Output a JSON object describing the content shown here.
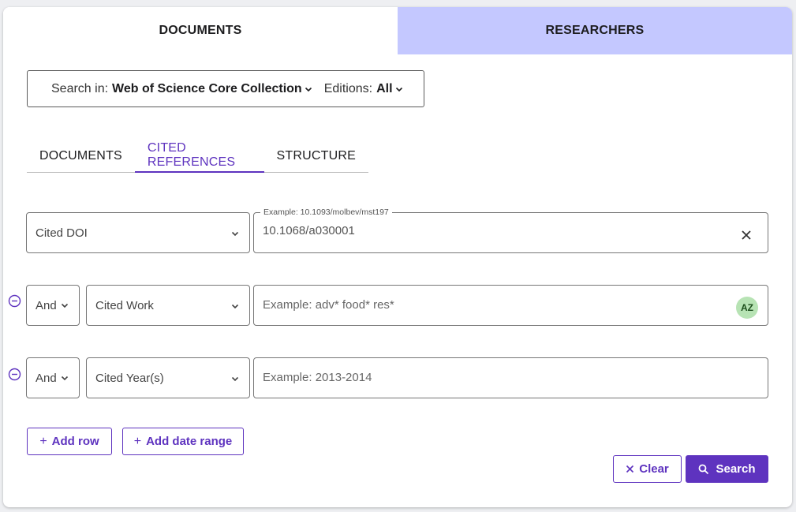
{
  "top_tabs": {
    "documents": "DOCUMENTS",
    "researchers": "RESEARCHERS"
  },
  "search_in": {
    "label": "Search in:",
    "collection": "Web of Science Core Collection",
    "editions_label": "Editions:",
    "editions_value": "All"
  },
  "sub_tabs": [
    "DOCUMENTS",
    "CITED REFERENCES",
    "STRUCTURE"
  ],
  "active_sub_tab": "CITED REFERENCES",
  "rows": [
    {
      "field": "Cited DOI",
      "label": "Example: 10.1093/molbev/mst197",
      "value": "10.1068/a030001"
    },
    {
      "operator": "And",
      "field": "Cited Work",
      "placeholder": "Example: adv* food* res*",
      "az_icon": "AZ"
    },
    {
      "operator": "And",
      "field": "Cited Year(s)",
      "placeholder": "Example: 2013-2014"
    }
  ],
  "buttons": {
    "add_row": "Add row",
    "add_date_range": "Add date range",
    "clear": "Clear",
    "search": "Search"
  },
  "colors": {
    "accent": "#5e33bf",
    "tab_inactive_bg": "#c4c8ff",
    "az_bg": "#b7e3b4"
  }
}
